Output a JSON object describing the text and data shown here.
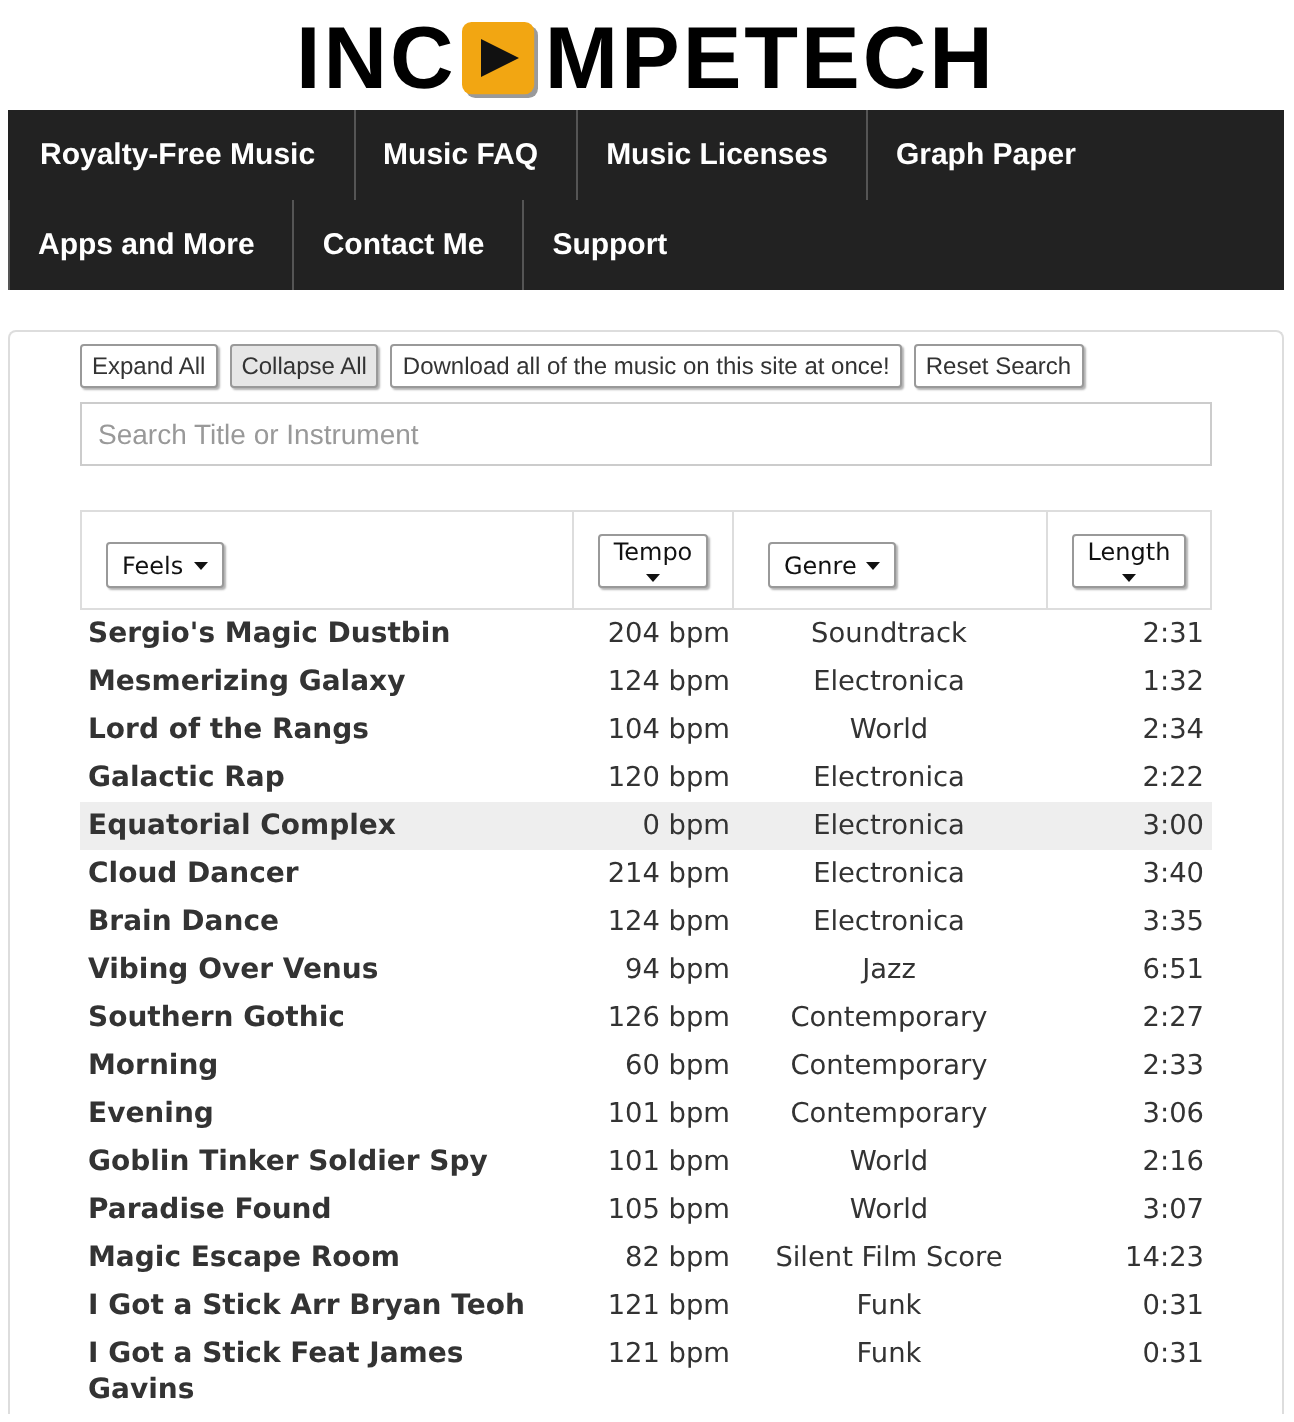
{
  "logo": {
    "text_before": "INC",
    "text_after": "MPETECH"
  },
  "nav": [
    "Royalty-Free Music",
    "Music FAQ",
    "Music Licenses",
    "Graph Paper",
    "Apps and More",
    "Contact Me",
    "Support"
  ],
  "toolbar": [
    {
      "label": "Expand All",
      "pressed": false
    },
    {
      "label": "Collapse All",
      "pressed": true
    },
    {
      "label": "Download all of the music on this site at once!",
      "pressed": false
    },
    {
      "label": "Reset Search",
      "pressed": false
    }
  ],
  "search": {
    "placeholder": "Search Title or Instrument"
  },
  "table": {
    "columns": [
      {
        "label": "Feels",
        "kind": "dropdown"
      },
      {
        "label": "Tempo",
        "kind": "sort"
      },
      {
        "label": "Genre",
        "kind": "dropdown"
      },
      {
        "label": "Length",
        "kind": "sort"
      }
    ],
    "rows": [
      {
        "title": "Sergio's Magic Dustbin",
        "tempo": "204 bpm",
        "genre": "Soundtrack",
        "length": "2:31",
        "highlighted": false
      },
      {
        "title": "Mesmerizing Galaxy",
        "tempo": "124 bpm",
        "genre": "Electronica",
        "length": "1:32",
        "highlighted": false
      },
      {
        "title": "Lord of the Rangs",
        "tempo": "104 bpm",
        "genre": "World",
        "length": "2:34",
        "highlighted": false
      },
      {
        "title": "Galactic Rap",
        "tempo": "120 bpm",
        "genre": "Electronica",
        "length": "2:22",
        "highlighted": false
      },
      {
        "title": "Equatorial Complex",
        "tempo": "0 bpm",
        "genre": "Electronica",
        "length": "3:00",
        "highlighted": true
      },
      {
        "title": "Cloud Dancer",
        "tempo": "214 bpm",
        "genre": "Electronica",
        "length": "3:40",
        "highlighted": false
      },
      {
        "title": "Brain Dance",
        "tempo": "124 bpm",
        "genre": "Electronica",
        "length": "3:35",
        "highlighted": false
      },
      {
        "title": "Vibing Over Venus",
        "tempo": "94 bpm",
        "genre": "Jazz",
        "length": "6:51",
        "highlighted": false
      },
      {
        "title": "Southern Gothic",
        "tempo": "126 bpm",
        "genre": "Contemporary",
        "length": "2:27",
        "highlighted": false
      },
      {
        "title": "Morning",
        "tempo": "60 bpm",
        "genre": "Contemporary",
        "length": "2:33",
        "highlighted": false
      },
      {
        "title": "Evening",
        "tempo": "101 bpm",
        "genre": "Contemporary",
        "length": "3:06",
        "highlighted": false
      },
      {
        "title": "Goblin Tinker Soldier Spy",
        "tempo": "101 bpm",
        "genre": "World",
        "length": "2:16",
        "highlighted": false
      },
      {
        "title": "Paradise Found",
        "tempo": "105 bpm",
        "genre": "World",
        "length": "3:07",
        "highlighted": false
      },
      {
        "title": "Magic Escape Room",
        "tempo": "82 bpm",
        "genre": "Silent Film Score",
        "length": "14:23",
        "highlighted": false
      },
      {
        "title": "I Got a Stick Arr Bryan Teoh",
        "tempo": "121 bpm",
        "genre": "Funk",
        "length": "0:31",
        "highlighted": false
      },
      {
        "title": "I Got a Stick Feat James Gavins",
        "tempo": "121 bpm",
        "genre": "Funk",
        "length": "0:31",
        "highlighted": false
      }
    ]
  }
}
